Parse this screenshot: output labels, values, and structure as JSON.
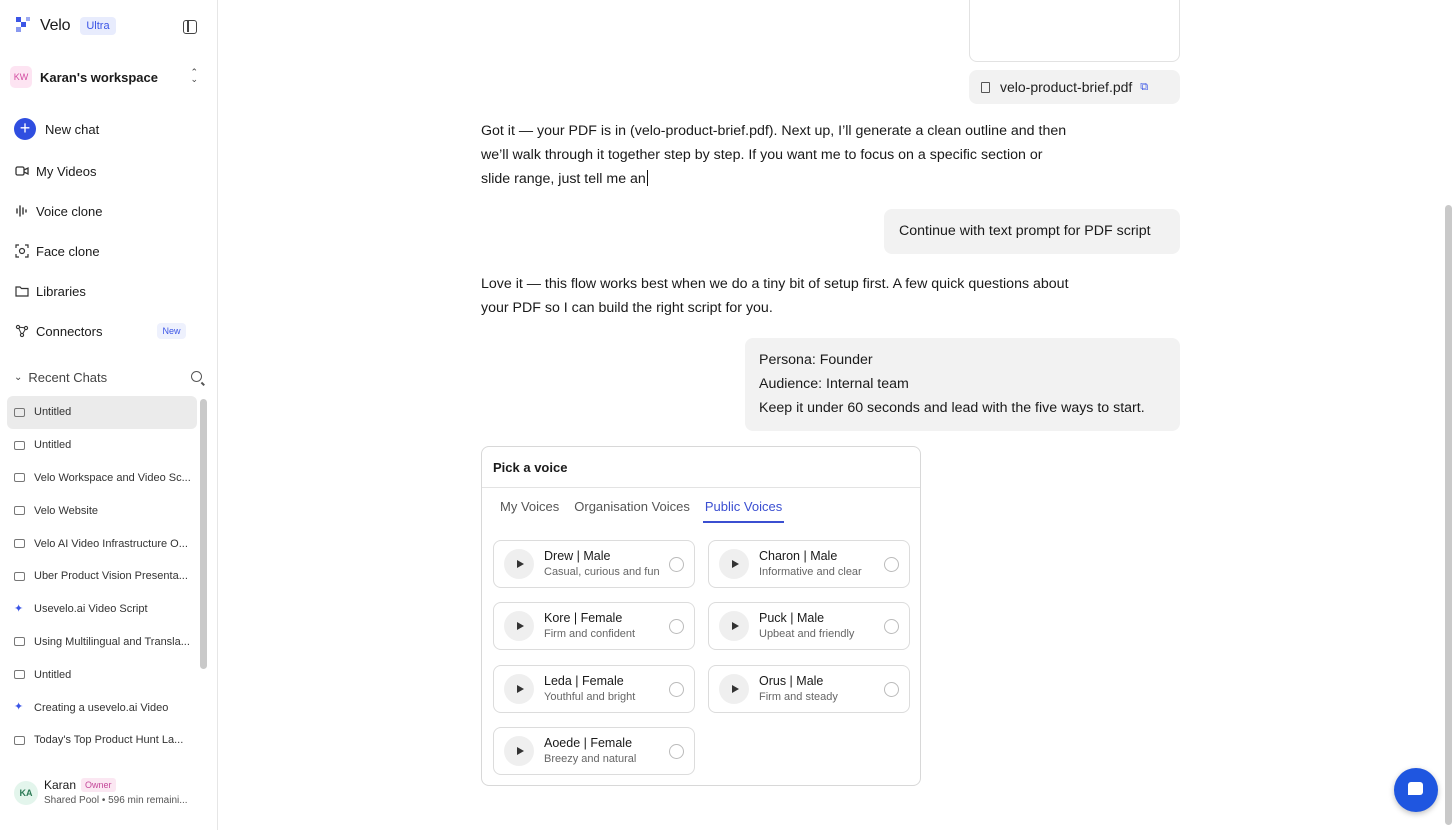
{
  "sidebar": {
    "brand": "Velo",
    "plan_badge": "Ultra",
    "workspace": {
      "initials": "KW",
      "name": "Karan's workspace"
    },
    "nav": [
      {
        "label": "New chat",
        "icon": "plus-icon"
      },
      {
        "label": "My Videos",
        "icon": "video-icon"
      },
      {
        "label": "Voice clone",
        "icon": "waveform-icon"
      },
      {
        "label": "Face clone",
        "icon": "face-scan-icon"
      },
      {
        "label": "Libraries",
        "icon": "folder-icon"
      },
      {
        "label": "Connectors",
        "icon": "nodes-icon",
        "badge": "New"
      }
    ],
    "recent_chats_label": "Recent Chats",
    "recent_chats": [
      {
        "label": "Untitled",
        "icon": "chat-icon"
      },
      {
        "label": "Untitled",
        "icon": "chat-icon"
      },
      {
        "label": "Velo Workspace and Video Sc...",
        "icon": "chat-icon"
      },
      {
        "label": "Velo Website",
        "icon": "chat-icon"
      },
      {
        "label": "Velo AI Video Infrastructure O...",
        "icon": "chat-icon"
      },
      {
        "label": "Uber Product Vision Presenta...",
        "icon": "chat-icon"
      },
      {
        "label": "Usevelo.ai Video Script",
        "icon": "spark-icon"
      },
      {
        "label": "Using Multilingual and Transla...",
        "icon": "chat-icon"
      },
      {
        "label": "Untitled",
        "icon": "chat-icon"
      },
      {
        "label": "Creating a usevelo.ai Video",
        "icon": "spark-icon"
      },
      {
        "label": "Today's Top Product Hunt La...",
        "icon": "chat-icon"
      }
    ],
    "user": {
      "initials": "KA",
      "name": "Karan",
      "role": "Owner",
      "sub": "Shared Pool • 596 min remaini..."
    }
  },
  "conversation": {
    "attachment": "velo-product-brief.pdf",
    "assistant_1": "Got it — your PDF is in (velo-product-brief.pdf). Next up, I’ll generate a clean outline and then we’ll walk through it together step by step. If you want me to focus on a specific section or slide range, just tell me an",
    "user_1": "Continue with text prompt for PDF script",
    "assistant_2": "Love it — this flow works best when we do a tiny bit of setup first. A few quick questions about your PDF so I can build the right script for you.",
    "user_2_lines": [
      "Persona: Founder",
      "Audience: Internal team",
      "Keep it under 60 seconds and lead with the five ways to start."
    ]
  },
  "voice_picker": {
    "title": "Pick a voice",
    "tabs": [
      "My Voices",
      "Organisation Voices",
      "Public Voices"
    ],
    "active_tab": "Public Voices",
    "voices": [
      {
        "name": "Drew | Male",
        "desc": "Casual, curious and fun"
      },
      {
        "name": "Charon | Male",
        "desc": "Informative and clear"
      },
      {
        "name": "Kore | Female",
        "desc": "Firm and confident"
      },
      {
        "name": "Puck | Male",
        "desc": "Upbeat and friendly"
      },
      {
        "name": "Leda | Female",
        "desc": "Youthful and bright"
      },
      {
        "name": "Orus | Male",
        "desc": "Firm and steady"
      },
      {
        "name": "Aoede | Female",
        "desc": "Breezy and natural"
      }
    ]
  },
  "colors": {
    "accent": "#3b55e6",
    "help_button": "#1f56e0"
  }
}
